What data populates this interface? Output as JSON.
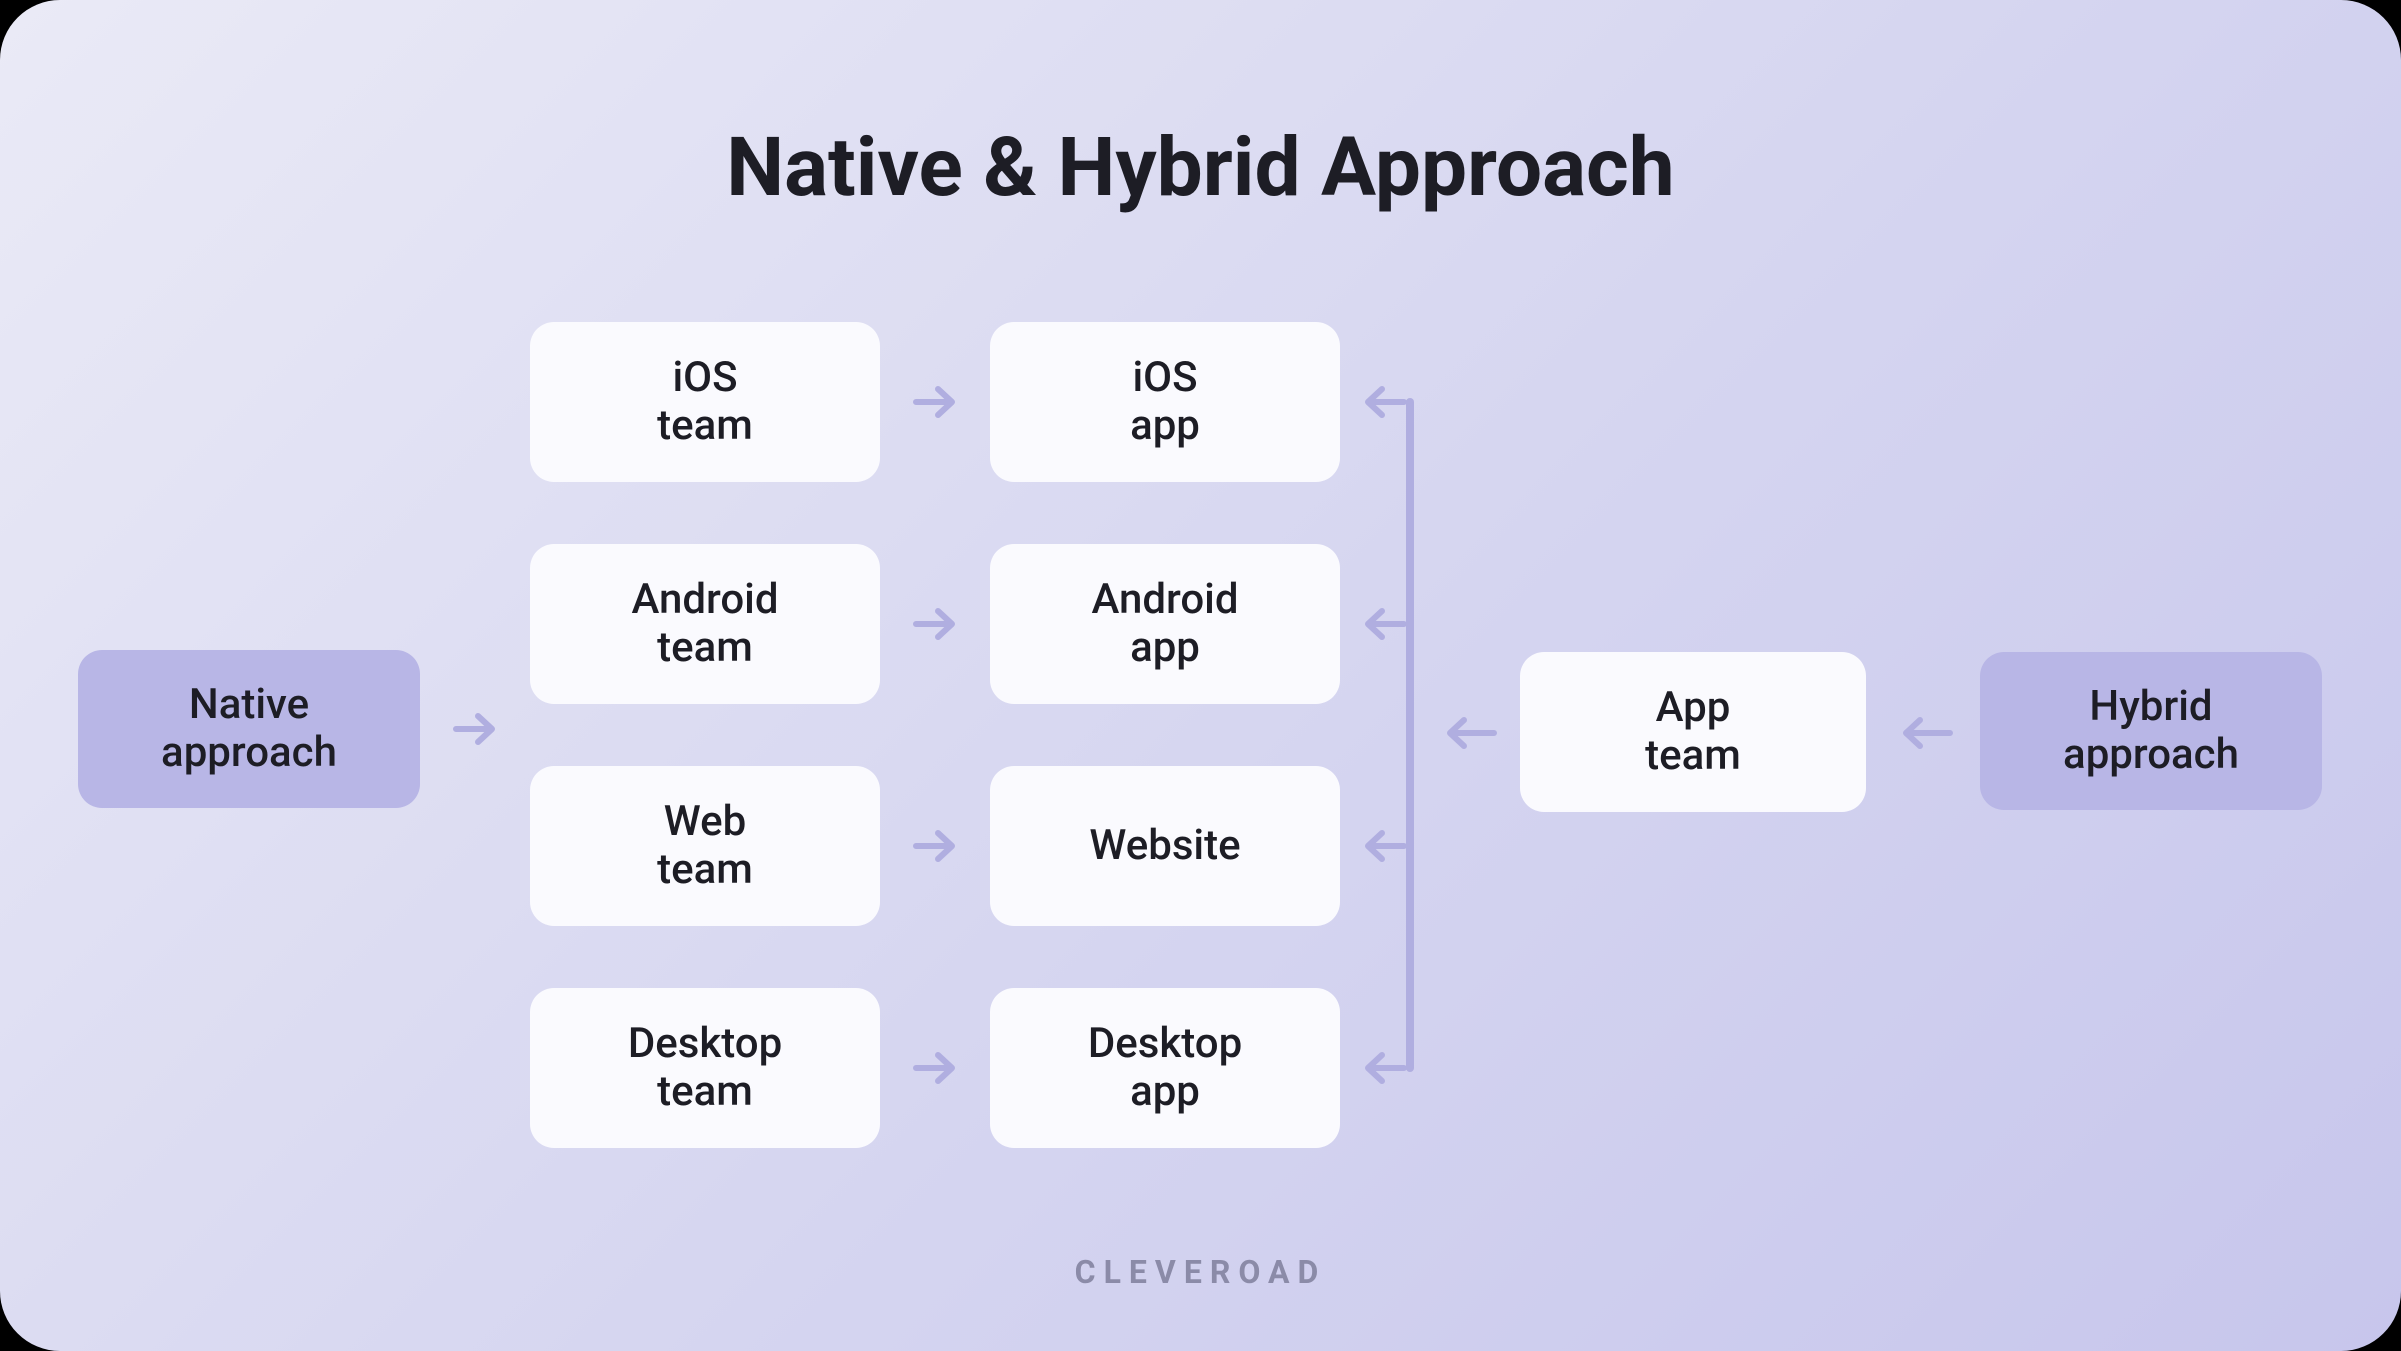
{
  "title": "Native & Hybrid Approach",
  "brand": "CLEVEROAD",
  "native": {
    "approach": "Native\napproach",
    "rows": [
      {
        "team": "iOS\nteam",
        "output": "iOS\napp"
      },
      {
        "team": "Android\nteam",
        "output": "Android\napp"
      },
      {
        "team": "Web\nteam",
        "output": "Website"
      },
      {
        "team": "Desktop\nteam",
        "output": "Desktop\napp"
      }
    ]
  },
  "hybrid": {
    "approach": "Hybrid\napproach",
    "team": "App\nteam"
  },
  "colors": {
    "accent_box": "#B8B6E6",
    "white_box": "#FAFAFE",
    "arrow": "#B0AEE0",
    "title_text": "#1d1d25"
  }
}
